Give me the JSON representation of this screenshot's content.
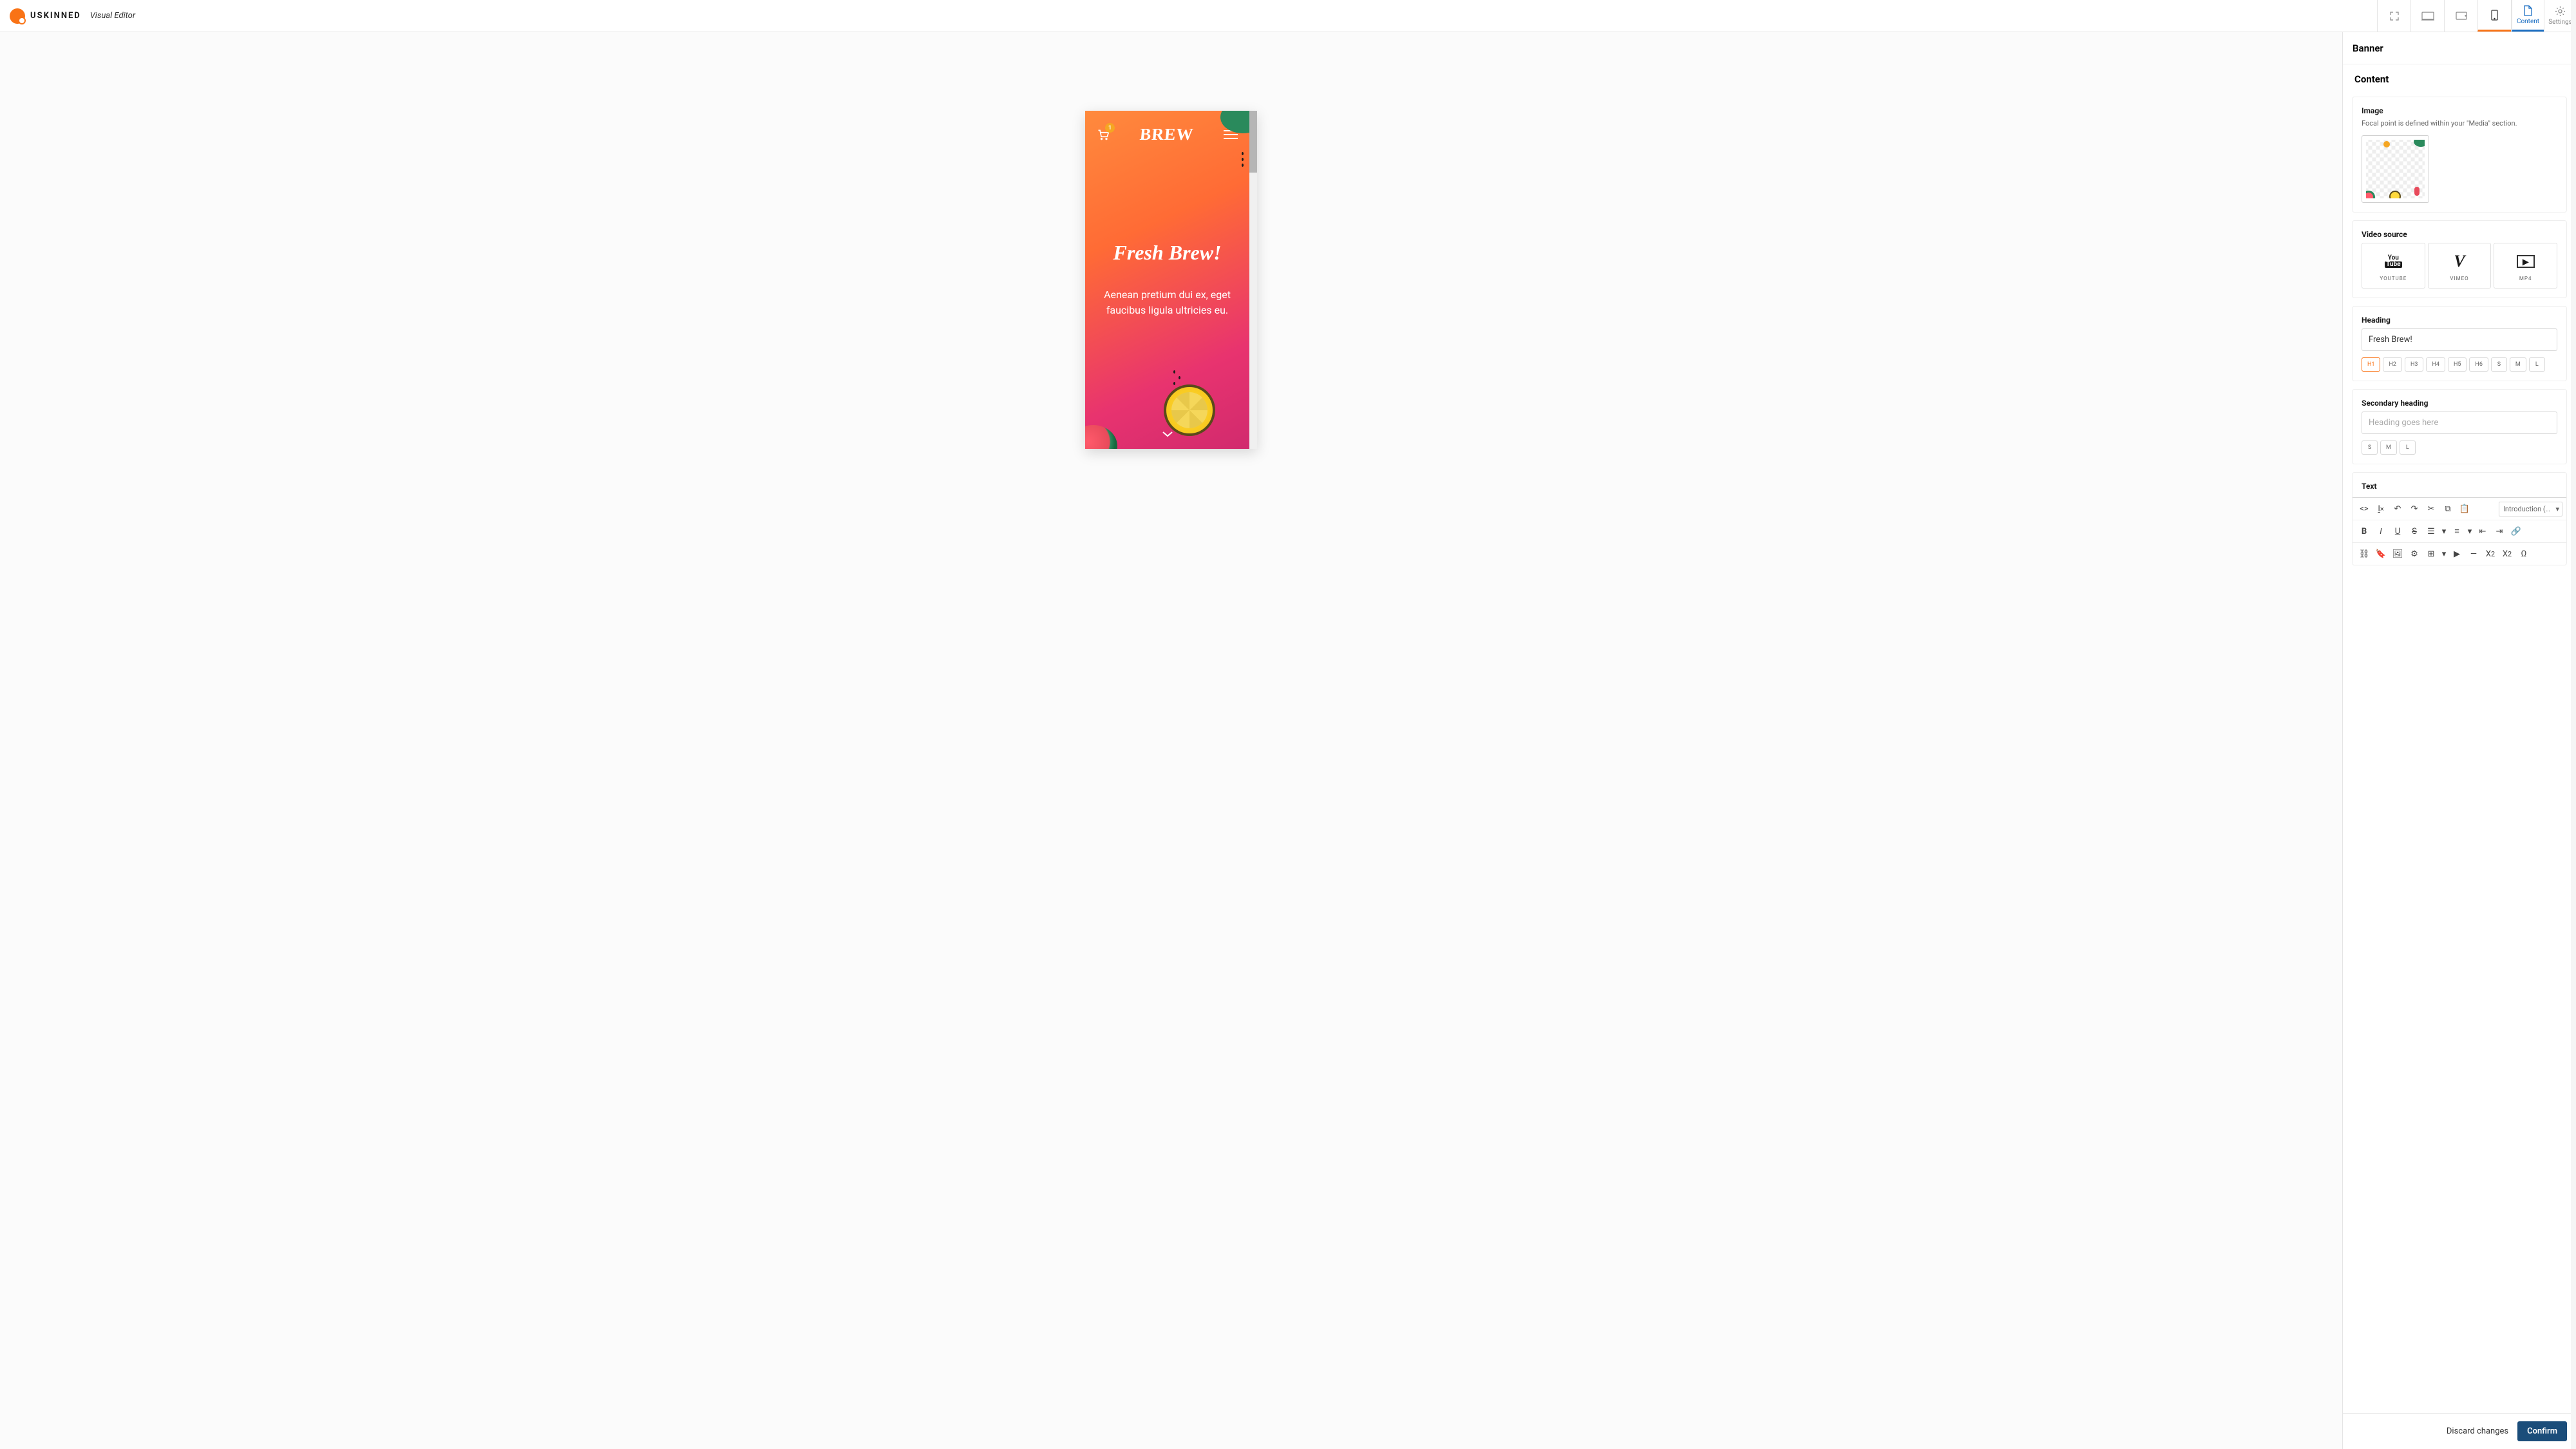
{
  "header": {
    "brand": "USKINNED",
    "mode": "Visual Editor"
  },
  "devices": {
    "fullscreen": "fullscreen",
    "desktop": "desktop",
    "tablet": "tablet",
    "mobile": "mobile",
    "active": "mobile"
  },
  "panel": {
    "title": "Banner",
    "tabs": {
      "content": "Content",
      "settings": "Settings"
    },
    "section_title": "Content",
    "image": {
      "label": "Image",
      "hint": "Focal point is defined within your \"Media\" section."
    },
    "video_source": {
      "label": "Video source",
      "options": [
        {
          "id": "youtube",
          "label": "YOUTUBE"
        },
        {
          "id": "vimeo",
          "label": "VIMEO"
        },
        {
          "id": "mp4",
          "label": "MP4"
        }
      ]
    },
    "heading": {
      "label": "Heading",
      "value": "Fresh Brew!",
      "sizes": [
        "H1",
        "H2",
        "H3",
        "H4",
        "H5",
        "H6",
        "S",
        "M",
        "L"
      ],
      "active_size": "H1"
    },
    "secondary_heading": {
      "label": "Secondary heading",
      "placeholder": "Heading goes here",
      "sizes": [
        "S",
        "M",
        "L"
      ]
    },
    "text": {
      "label": "Text",
      "format_dropdown": "Introduction (…"
    }
  },
  "preview": {
    "logo": "BREW",
    "cart_count": "1",
    "heading": "Fresh Brew!",
    "body": "Aenean pretium dui ex, eget faucibus ligula ultricies eu."
  },
  "footer": {
    "discard": "Discard changes",
    "confirm": "Confirm"
  }
}
